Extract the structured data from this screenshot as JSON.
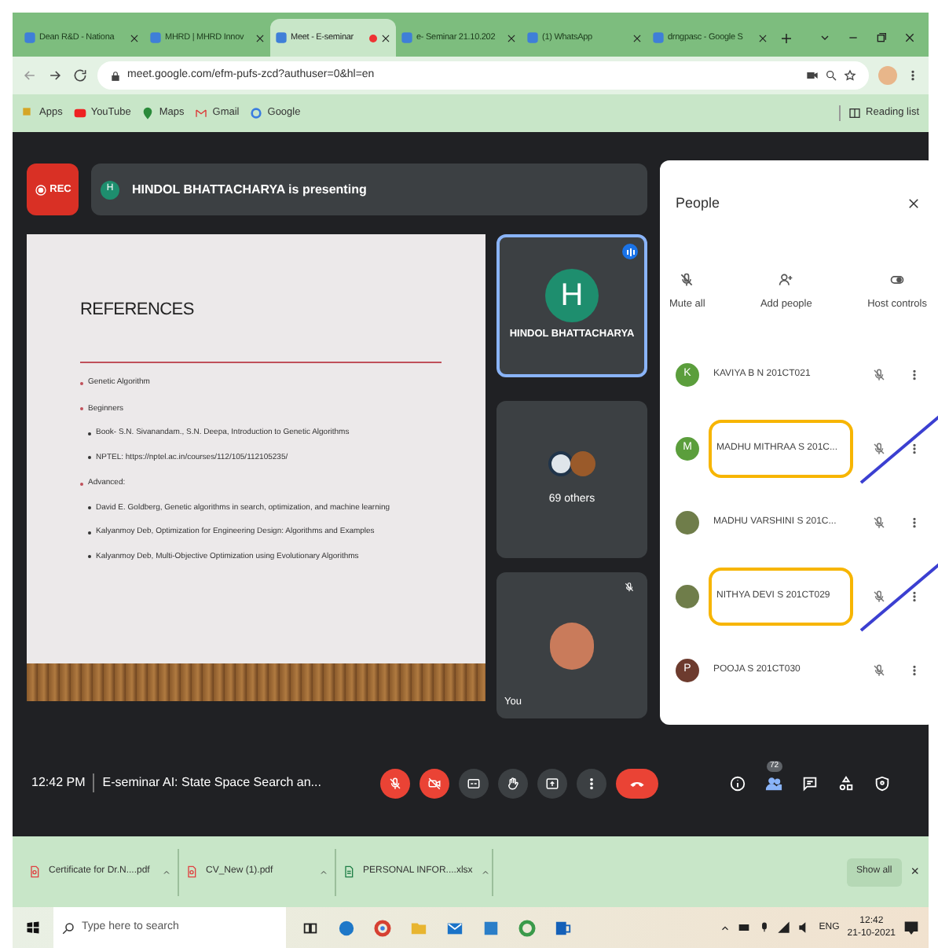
{
  "browser": {
    "tabs": [
      {
        "title": "Dean R&D - Nationa",
        "selected": false,
        "recording": false
      },
      {
        "title": "MHRD | MHRD Innov",
        "selected": false,
        "recording": false
      },
      {
        "title": "Meet - E-seminar",
        "selected": true,
        "recording": true
      },
      {
        "title": "e- Seminar 21.10.202",
        "selected": false,
        "recording": false
      },
      {
        "title": "(1) WhatsApp",
        "selected": false,
        "recording": false
      },
      {
        "title": "drngpasc - Google S",
        "selected": false,
        "recording": false
      }
    ],
    "address": "meet.google.com/efm-pufs-zcd?authuser=0&hl=en",
    "bookmarks": [
      "Apps",
      "YouTube",
      "Maps",
      "Gmail",
      "Google"
    ],
    "reading_list": "Reading list"
  },
  "meet": {
    "rec": "REC",
    "presenter_initial": "H",
    "presenting": "HINDOL BHATTACHARYA is presenting",
    "slide": {
      "title": "REFERENCES",
      "items": [
        {
          "text": "Genetic Algorithm",
          "kind": "main"
        },
        {
          "text": "Beginners",
          "kind": "main"
        },
        {
          "text": "Book- S.N. Sivanandam., S.N. Deepa, Introduction to Genetic Algorithms",
          "kind": "sub"
        },
        {
          "text": "NPTEL: https://nptel.ac.in/courses/112/105/112105235/",
          "kind": "sub"
        },
        {
          "text": "Advanced:",
          "kind": "main"
        },
        {
          "text": "David E. Goldberg, Genetic algorithms in search, optimization, and machine learning",
          "kind": "sub"
        },
        {
          "text": "Kalyanmoy Deb, Optimization for Engineering Design: Algorithms and Examples",
          "kind": "sub"
        },
        {
          "text": "Kalyanmoy Deb, Multi-Objective Optimization using Evolutionary Algorithms",
          "kind": "sub"
        }
      ]
    },
    "tiles": [
      {
        "kind": "speaker",
        "initial": "H",
        "name": "HINDOL BHATTACHARYA"
      },
      {
        "kind": "group",
        "name": "69 others"
      },
      {
        "kind": "self",
        "name": "You"
      }
    ],
    "people": {
      "title": "People",
      "actions": [
        {
          "kind": "mute",
          "label": "Mute all"
        },
        {
          "kind": "add",
          "label": "Add people"
        },
        {
          "kind": "host",
          "label": "Host controls"
        }
      ],
      "participants": [
        {
          "name": "KAVIYA B N 201CT021",
          "kind": "letter",
          "initial": "K",
          "color": "#5b9e3c",
          "annotated": false
        },
        {
          "name": "MADHU MITHRAA S 201C...",
          "kind": "letter",
          "initial": "M",
          "color": "#5b9e3c",
          "annotated": true
        },
        {
          "name": "MADHU VARSHINI S 201C...",
          "kind": "photo",
          "annotated": false
        },
        {
          "name": "NITHYA DEVI S 201CT029",
          "kind": "photo",
          "annotated": true
        },
        {
          "name": "POOJA S 201CT030",
          "kind": "letter",
          "initial": "P",
          "color": "#6d3b2e",
          "annotated": false
        }
      ]
    },
    "time": "12:42 PM",
    "meeting_title": "E-seminar AI: State Space Search an...",
    "controls": [
      {
        "kind": "mic",
        "on": false
      },
      {
        "kind": "camera",
        "on": false
      },
      {
        "kind": "captions",
        "on": false
      },
      {
        "kind": "hand",
        "on": false
      },
      {
        "kind": "present",
        "on": false
      },
      {
        "kind": "more"
      },
      {
        "kind": "leave"
      }
    ],
    "side_buttons": [
      {
        "kind": "info",
        "selected": false
      },
      {
        "kind": "people",
        "selected": true,
        "badge": "72"
      },
      {
        "kind": "chat",
        "selected": false
      },
      {
        "kind": "activities",
        "selected": false
      },
      {
        "kind": "lock",
        "selected": false
      }
    ]
  },
  "downloads": {
    "files": [
      {
        "name": "Certificate for Dr.N....pdf",
        "kind": "pdf"
      },
      {
        "name": "CV_New (1).pdf",
        "kind": "pdf"
      },
      {
        "name": "PERSONAL INFOR....xlsx",
        "kind": "sheet"
      }
    ],
    "show_all": "Show all",
    "close": "×"
  },
  "taskbar": {
    "search_placeholder": "Type here to search",
    "language": "ENG",
    "time": "12:42",
    "date": "21-10-2021"
  }
}
